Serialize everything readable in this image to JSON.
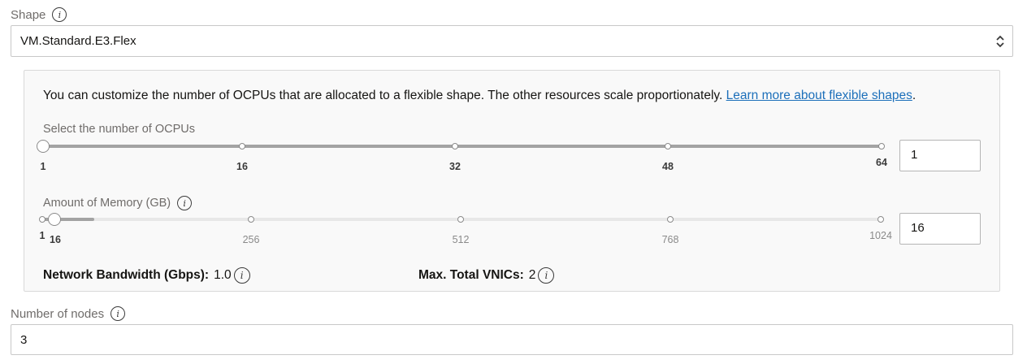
{
  "shape": {
    "label": "Shape",
    "info_icon": "info-icon",
    "selected": "VM.Standard.E3.Flex",
    "chevron_icon": "chevron-up-down-icon"
  },
  "panel": {
    "description": "You can customize the number of OCPUs that are allocated to a flexible shape. The other resources scale proportionately.",
    "link_text": "Learn more about flexible shapes",
    "description_end": ".",
    "ocpu": {
      "label": "Select the number of OCPUs",
      "ticks": [
        "1",
        "16",
        "32",
        "48",
        "64"
      ],
      "value": "1"
    },
    "memory": {
      "label": "Amount of Memory (GB)",
      "ticks": [
        "1",
        "16",
        "256",
        "512",
        "768",
        "1024"
      ],
      "value": "16"
    },
    "network": {
      "label": "Network Bandwidth (Gbps):",
      "value": "1.0"
    },
    "vnics": {
      "label": "Max. Total VNICs:",
      "value": "2"
    }
  },
  "nodes": {
    "label": "Number of nodes",
    "value": "3"
  },
  "colors": {
    "link": "#1c6fba",
    "track_active": "#a3a3a3",
    "track_inactive": "#e8e8e8"
  }
}
